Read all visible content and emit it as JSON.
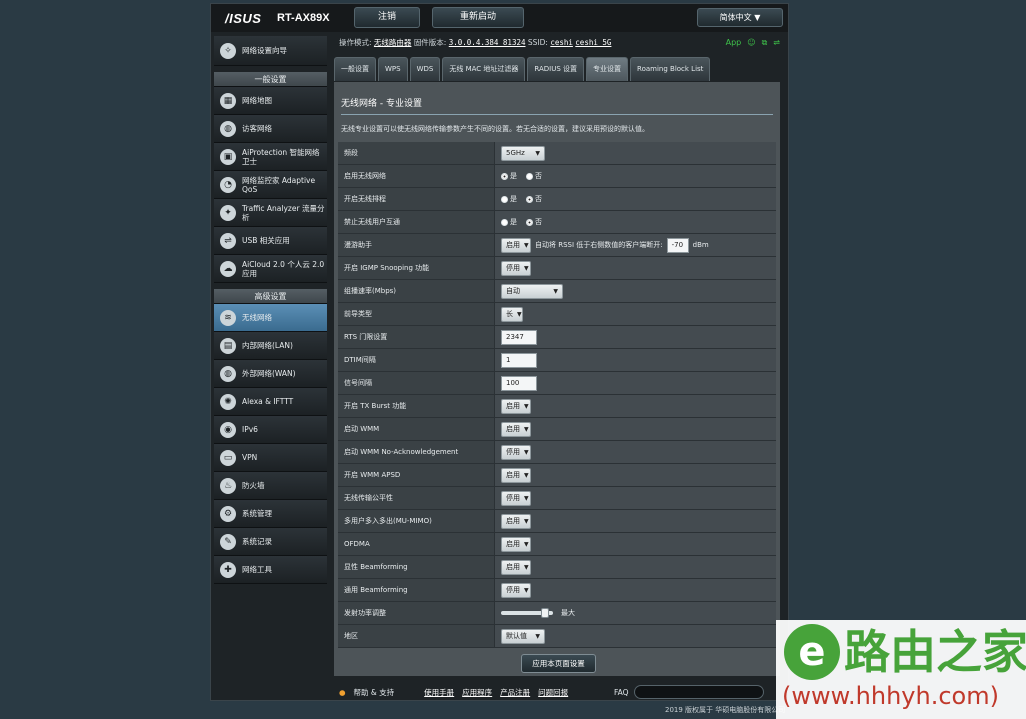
{
  "header": {
    "logo": "/ISUS",
    "model": "RT-AX89X",
    "logout": "注销",
    "reboot": "重新启动",
    "language": "简体中文"
  },
  "status": {
    "mode_label": "操作模式:",
    "mode_value": "无线路由器",
    "fw_label": "固件版本:",
    "fw_value": "3.0.0.4.384_81324",
    "ssid_label": "SSID:",
    "ssid1": "ceshi",
    "ssid2": "ceshi_5G",
    "app": "App"
  },
  "sidebar": {
    "setup_wizard": "网络设置向导",
    "general_head": "一般设置",
    "general": [
      {
        "label": "网络地图",
        "icon": "map-icon"
      },
      {
        "label": "访客网络",
        "icon": "globe-icon"
      },
      {
        "label": "AiProtection 智能网络卫士",
        "icon": "lock-icon"
      },
      {
        "label": "网络监控家 Adaptive QoS",
        "icon": "gauge-icon"
      },
      {
        "label": "Traffic Analyzer 流量分析",
        "icon": "analyzer-icon"
      },
      {
        "label": "USB 相关应用",
        "icon": "usb-icon"
      },
      {
        "label": "AiCloud 2.0 个人云 2.0 应用",
        "icon": "cloud-icon"
      }
    ],
    "advanced_head": "高级设置",
    "advanced": [
      {
        "label": "无线网络",
        "icon": "wifi-icon",
        "active": true
      },
      {
        "label": "内部网络(LAN)",
        "icon": "lan-icon"
      },
      {
        "label": "外部网络(WAN)",
        "icon": "wan-globe-icon"
      },
      {
        "label": "Alexa & IFTTT",
        "icon": "alexa-icon"
      },
      {
        "label": "IPv6",
        "icon": "ipv6-icon"
      },
      {
        "label": "VPN",
        "icon": "vpn-icon"
      },
      {
        "label": "防火墙",
        "icon": "firewall-icon"
      },
      {
        "label": "系统管理",
        "icon": "admin-gear-icon"
      },
      {
        "label": "系统记录",
        "icon": "log-icon"
      },
      {
        "label": "网络工具",
        "icon": "tools-icon"
      }
    ]
  },
  "tabs": [
    "一般设置",
    "WPS",
    "WDS",
    "无线 MAC 地址过滤器",
    "RADIUS 设置",
    "专业设置",
    "Roaming Block List"
  ],
  "panel": {
    "title": "无线网络 - 专业设置",
    "desc": "无线专业设置可以使无线网络传输参数产生不同的设置。若无合适的设置，建议采用预设的默认值。"
  },
  "rows": {
    "band": {
      "label": "频段",
      "value": "5GHz"
    },
    "radio": {
      "label": "启用无线网络",
      "yes": "是",
      "no": "否"
    },
    "schedule": {
      "label": "开启无线排程",
      "yes": "是",
      "no": "否"
    },
    "isolate": {
      "label": "禁止无线用户互通",
      "yes": "是",
      "no": "否"
    },
    "roaming": {
      "label": "漫游助手",
      "value": "启用",
      "text": "自动将 RSSI 低于右侧数值的客户端断开:",
      "rssi": "-70",
      "unit": "dBm"
    },
    "igmp": {
      "label": "开启 IGMP Snooping 功能",
      "value": "停用"
    },
    "mcast": {
      "label": "组播速率(Mbps)",
      "value": "自动"
    },
    "preamble": {
      "label": "前导类型",
      "value": "长"
    },
    "rts": {
      "label": "RTS 门限设置",
      "value": "2347"
    },
    "dtim": {
      "label": "DTIM间隔",
      "value": "1"
    },
    "beacon": {
      "label": "信号间隔",
      "value": "100"
    },
    "txburst": {
      "label": "开启 TX Burst 功能",
      "value": "启用"
    },
    "wmm": {
      "label": "启动 WMM",
      "value": "启用"
    },
    "wmmnoack": {
      "label": "启动 WMM No-Acknowledgement",
      "value": "停用"
    },
    "apsd": {
      "label": "开启 WMM APSD",
      "value": "启用"
    },
    "airtime": {
      "label": "无线传输公平性",
      "value": "停用"
    },
    "mumimo": {
      "label": "多用户多入多出(MU-MIMO)",
      "value": "启用"
    },
    "ofdma": {
      "label": "OFDMA",
      "value": "启用"
    },
    "explicit_bf": {
      "label": "显性 Beamforming",
      "value": "启用"
    },
    "universal_bf": {
      "label": "通用 Beamforming",
      "value": "停用"
    },
    "txpower": {
      "label": "发射功率调整",
      "value": "最大",
      "level": 0.92
    },
    "region": {
      "label": "地区",
      "value": "默认值"
    }
  },
  "apply": "应用本页面设置",
  "footer": {
    "help": "帮助 & 支持",
    "manual": "使用手册",
    "utility": "应用程序",
    "register": "产品注册",
    "feedback": "问题回报",
    "faq": "FAQ",
    "copyright": "2019 版权属于 华硕电脑股份有限公司"
  },
  "watermark": {
    "name": "路由之家",
    "url": "(www.hhhyh.com)"
  }
}
